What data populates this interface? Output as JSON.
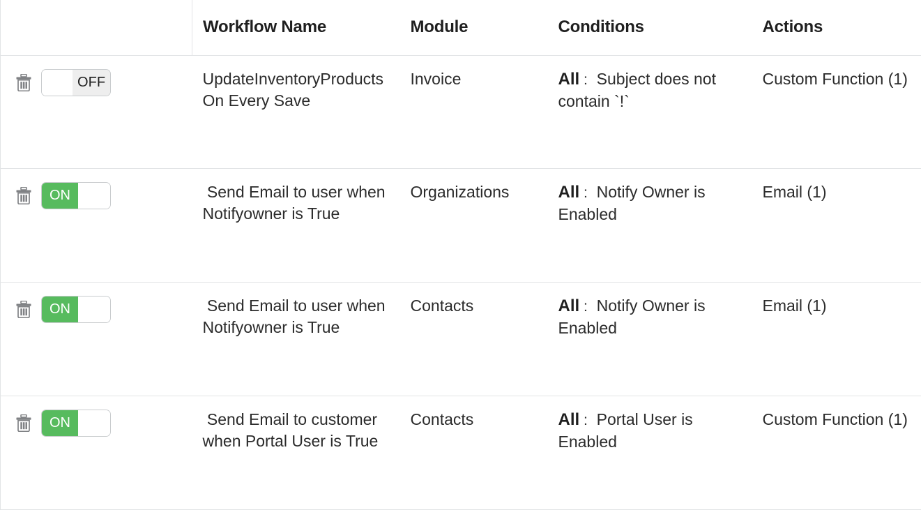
{
  "table": {
    "columns": [
      {
        "key": "controls",
        "label": ""
      },
      {
        "key": "name",
        "label": "Workflow Name"
      },
      {
        "key": "module",
        "label": "Module"
      },
      {
        "key": "conditions",
        "label": "Conditions"
      },
      {
        "key": "actions",
        "label": "Actions"
      }
    ],
    "toggle_labels": {
      "on": "ON",
      "off": "OFF"
    },
    "delete_icon": "trash-icon",
    "accent_on_color": "#57bb5e",
    "off_track_color": "#eeeeee",
    "border_color": "#e2e4e6",
    "rows": [
      {
        "toggle_state": "off",
        "toggle_label": "OFF",
        "name": "UpdateInventoryProducts On Every Save",
        "module": "Invoice",
        "condition_prefix": "All",
        "condition_colon": ":",
        "condition_text": "Subject does not contain `!`",
        "actions": "Custom Function (1)"
      },
      {
        "toggle_state": "on",
        "toggle_label": "ON",
        "name": " Send Email to user when Notifyowner is True",
        "module": "Organizations",
        "condition_prefix": "All",
        "condition_colon": ":",
        "condition_text": "Notify Owner is Enabled",
        "actions": "Email (1)"
      },
      {
        "toggle_state": "on",
        "toggle_label": "ON",
        "name": " Send Email to user when Notifyowner is True",
        "module": "Contacts",
        "condition_prefix": "All",
        "condition_colon": ":",
        "condition_text": "Notify Owner is Enabled",
        "actions": "Email (1)"
      },
      {
        "toggle_state": "on",
        "toggle_label": "ON",
        "name": " Send Email to customer when Portal User is True",
        "module": "Contacts",
        "condition_prefix": "All",
        "condition_colon": ":",
        "condition_text": "Portal User is Enabled",
        "actions": "Custom Function (1)"
      }
    ]
  }
}
